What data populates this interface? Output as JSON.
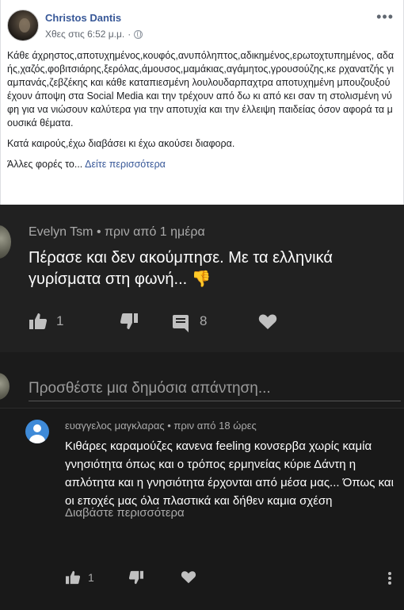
{
  "post": {
    "author": "Christos Dantis",
    "timestamp": "Χθες στις 6:52 μ.μ.",
    "separator": "·",
    "more_icon": "more-horizontal-icon",
    "audience_icon": "globe-icon",
    "paragraph1": "Κάθε άχρηστος,αποτυχημένος,κουφός,ανυπόληπτος,αδικημένος,ερωτοχτυπημένος, αδαής,χαζός,φοβιτσιάρης,ξερόλας,άμουσος,μαμάκιας,αγάμητος,γρουσούζης,κε ρχανατζής γιαμπανάς,ζεβζέκης και κάθε καταπιεσμένη λουλουδαρπαχτρα αποτυχημένη μπουζουξού έχουν άποψη στα Social Media και την τρέχουν από δω κι από κει σαν τη στολισμένη νύφη για να νιώσουν καλύτερα για την αποτυχία και την έλλειψη παιδείας όσον αφορά τα μουσικά θέματα.",
    "paragraph2": "Κατά καιρούς,έχω διαβάσει κι έχω ακούσει διαφορα.",
    "paragraph3_prefix": "Άλλες φορές το...",
    "see_more": "Δείτε περισσότερα"
  },
  "comment1": {
    "author": "Evelyn Tsm",
    "time": "• πριν από 1 ημέρα",
    "text": "Πέρασε και δεν ακούμπησε. Με τα ελληνικά γυρίσματα στη φωνή...",
    "emoji": "👎",
    "likes": "1",
    "replies": "8",
    "icons": [
      "thumbs-up-icon",
      "thumbs-down-icon",
      "reply-icon",
      "heart-icon"
    ]
  },
  "add_reply": {
    "placeholder": "Προσθέστε μια δημόσια απάντηση..."
  },
  "comment2": {
    "author": "ευαγγελος μαγκλαρας",
    "time": "• πριν από 18 ώρες",
    "text": "Κιθάρες καραμούζες κανενα feeling κονσερβα χωρίς καμία γνησιότητα όπως και ο τρόπος ερμηνείας κύριε Δάντη η απλότητα και η γνησιότητα έρχονται από μέσα μας... Όπως και οι εποχές μας όλα πλαστικά και δήθεν καμια σχέση",
    "read_more": "Διαβάστε περισσότερα",
    "likes": "1"
  },
  "colors": {
    "facebook_link": "#385898",
    "yt_background": "#212121",
    "yt_secondary_text": "#aaaaaa",
    "default_avatar_blue": "#3e8ad8",
    "emoji_yellow": "#f2b233"
  }
}
